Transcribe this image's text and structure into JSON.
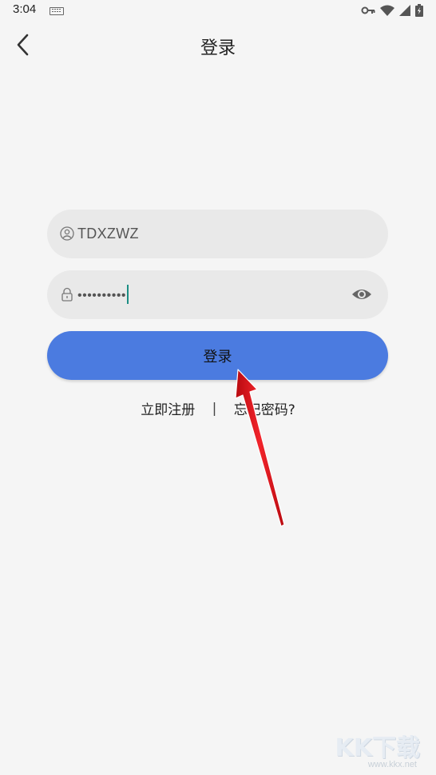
{
  "status_bar": {
    "time": "3:04",
    "icons": [
      "keyboard-icon",
      "vpn-key-icon",
      "wifi-icon",
      "signal-icon",
      "battery-icon"
    ]
  },
  "app_bar": {
    "title": "登录",
    "back_icon": "chevron-left-icon"
  },
  "form": {
    "username": {
      "icon": "user-icon",
      "value": "TDXZWZ"
    },
    "password": {
      "icon": "lock-icon",
      "masked_value": "••••••••••",
      "toggle_icon": "eye-icon"
    },
    "submit_label": "登录"
  },
  "links": {
    "register": "立即注册",
    "separator": "|",
    "forgot_password": "忘记密码?"
  },
  "watermark": {
    "text": "KK下载",
    "url": "www.kkx.net"
  },
  "colors": {
    "background": "#f5f5f5",
    "field": "#e9e9e9",
    "primary_button": "#4b7be0",
    "cursor": "#1b8e84",
    "annotation_arrow": "#e8141b"
  }
}
